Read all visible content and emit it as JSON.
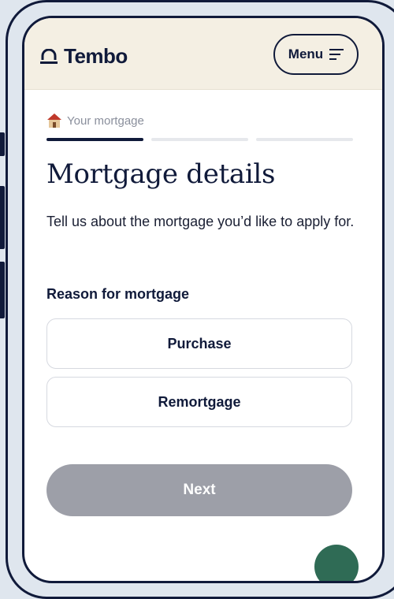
{
  "header": {
    "logo_text": "Tembo",
    "menu_label": "Menu"
  },
  "breadcrumb": {
    "label": "Your mortgage",
    "icon": "house-icon"
  },
  "progress": {
    "total_steps": 3,
    "active_step": 1
  },
  "page": {
    "title": "Mortgage details",
    "intro": "Tell us about the mortgage you’d like to apply for."
  },
  "reason": {
    "label": "Reason for mortgage",
    "options": [
      "Purchase",
      "Remortgage"
    ]
  },
  "actions": {
    "next_label": "Next"
  },
  "colors": {
    "navy": "#101a3a",
    "header_bg": "#f4efe3",
    "disabled_button": "#9d9fa8",
    "chat_green": "#2f6b55"
  }
}
